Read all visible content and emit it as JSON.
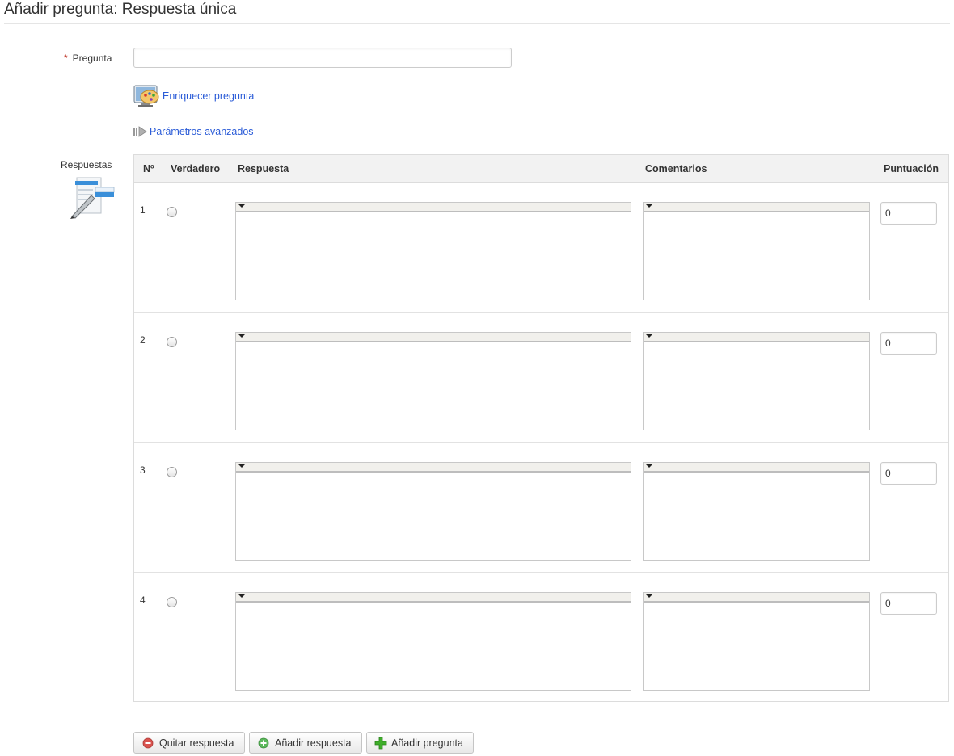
{
  "page": {
    "title": "Añadir pregunta: Respuesta única"
  },
  "question": {
    "required_marker": "*",
    "label": "Pregunta",
    "value": "",
    "enrich_link": "Enriquecer pregunta",
    "advanced_link": "Parámetros avanzados"
  },
  "answers": {
    "label": "Respuestas",
    "headers": {
      "number": "Nº",
      "true": "Verdadero",
      "answer": "Respuesta",
      "comments": "Comentarios",
      "score": "Puntuación"
    },
    "rows": [
      {
        "number": "1",
        "selected": false,
        "answer": "",
        "comment": "",
        "score": "0"
      },
      {
        "number": "2",
        "selected": false,
        "answer": "",
        "comment": "",
        "score": "0"
      },
      {
        "number": "3",
        "selected": false,
        "answer": "",
        "comment": "",
        "score": "0"
      },
      {
        "number": "4",
        "selected": false,
        "answer": "",
        "comment": "",
        "score": "0"
      }
    ]
  },
  "buttons": {
    "remove_answer": "Quitar respuesta",
    "add_answer": "Añadir respuesta",
    "add_question": "Añadir pregunta"
  },
  "icons": {
    "enrich": "palette-monitor-icon",
    "advanced": "arrow-right-icon",
    "answers": "form-edit-icon",
    "remove": "minus-circle-icon",
    "add_answer": "plus-circle-icon",
    "add_question": "plus-icon"
  },
  "colors": {
    "link": "#2a5bd7",
    "required": "#c0392b",
    "remove_icon": "#d9534f",
    "add_icon": "#5cb85c",
    "add_question_icon": "#3fae2a"
  }
}
